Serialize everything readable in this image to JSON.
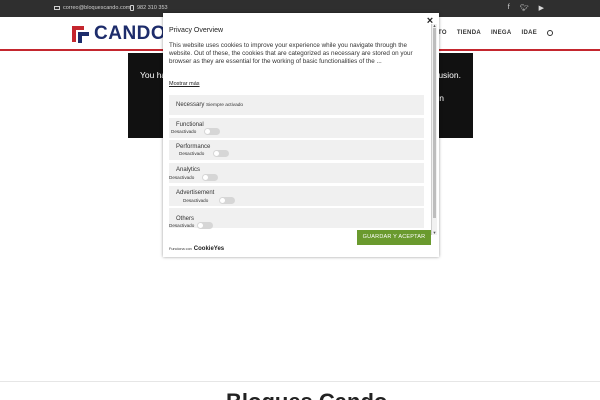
{
  "topbar": {
    "email": "correo@bloquescando.com",
    "phone": "982 310 353",
    "socials": [
      "facebook-icon",
      "twitter-icon",
      "youtube-icon"
    ]
  },
  "header": {
    "logo_text": "CANDO",
    "nav": [
      "TO",
      "TIENDA",
      "INEGA",
      "IDAE"
    ]
  },
  "hero": {
    "line1": "You ha",
    "line1_right": "usion.",
    "line2_right": "n"
  },
  "footer": {
    "title": "Bloques Cando"
  },
  "modal": {
    "title": "Privacy Overview",
    "description": "This website uses cookies to improve your experience while you navigate through the website. Out of these, the cookies that are categorized as necessary are stored on your browser as they are essential for the working of basic functionalities of the ...",
    "show_more": "Mostrar más",
    "categories": [
      {
        "label": "Necessary",
        "status": "Siempre activado"
      },
      {
        "label": "Functional",
        "status": "Desactivado"
      },
      {
        "label": "Performance",
        "status": "Desactivado"
      },
      {
        "label": "Analytics",
        "status": "Desactivado"
      },
      {
        "label": "Advertisement",
        "status": "Desactivado"
      },
      {
        "label": "Others",
        "status": "Desactivado"
      }
    ],
    "close": "×",
    "save_button": "GUARDAR Y ACEPTAR",
    "powered_by": "Funciona con",
    "powered_brand": "CookieYes"
  },
  "colors": {
    "accent_red": "#c4262e",
    "brand_navy": "#1d2c6b",
    "save_green": "#6a9a2e"
  }
}
